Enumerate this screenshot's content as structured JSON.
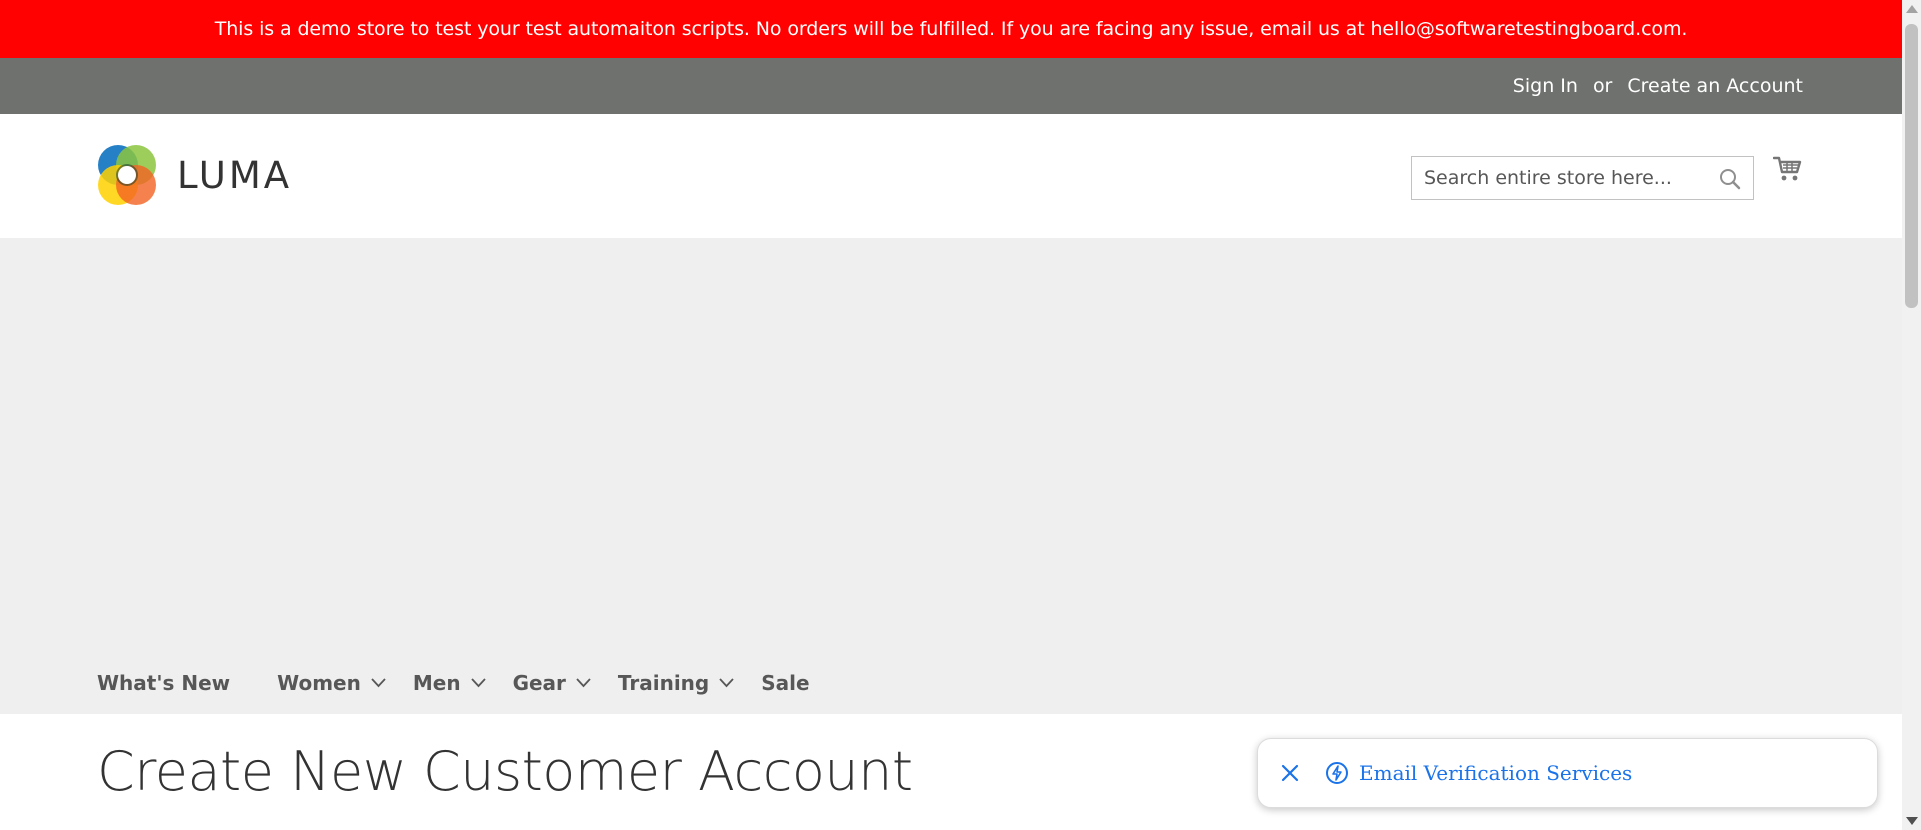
{
  "demo_banner": {
    "text": "This is a demo store to test your test automaiton scripts. No orders will be fulfilled. If you are facing any issue, email us at hello@softwaretestingboard.com."
  },
  "header": {
    "sign_in": "Sign In",
    "or": "or",
    "create_account": "Create an Account"
  },
  "logo": {
    "text": "LUMA",
    "colors": [
      "#1979c3",
      "#ffd100",
      "#f26322",
      "#8cc63f"
    ]
  },
  "search": {
    "placeholder": "Search entire store here...",
    "value": "",
    "icon": "search-icon"
  },
  "cart": {
    "icon": "cart-icon"
  },
  "nav": {
    "items": [
      {
        "label": "What's New",
        "has_submenu": false
      },
      {
        "label": "Women",
        "has_submenu": true
      },
      {
        "label": "Men",
        "has_submenu": true
      },
      {
        "label": "Gear",
        "has_submenu": true
      },
      {
        "label": "Training",
        "has_submenu": true
      },
      {
        "label": "Sale",
        "has_submenu": false
      }
    ]
  },
  "main": {
    "title": "Create New Customer Account"
  },
  "popup": {
    "label": "Email Verification Services",
    "close_icon": "close-icon",
    "bolt_icon": "bolt-icon",
    "color": "#1a73e8"
  },
  "colors": {
    "banner_bg": "#ff0101",
    "header_bg": "#6e716e",
    "nav_bg": "#efefef"
  }
}
